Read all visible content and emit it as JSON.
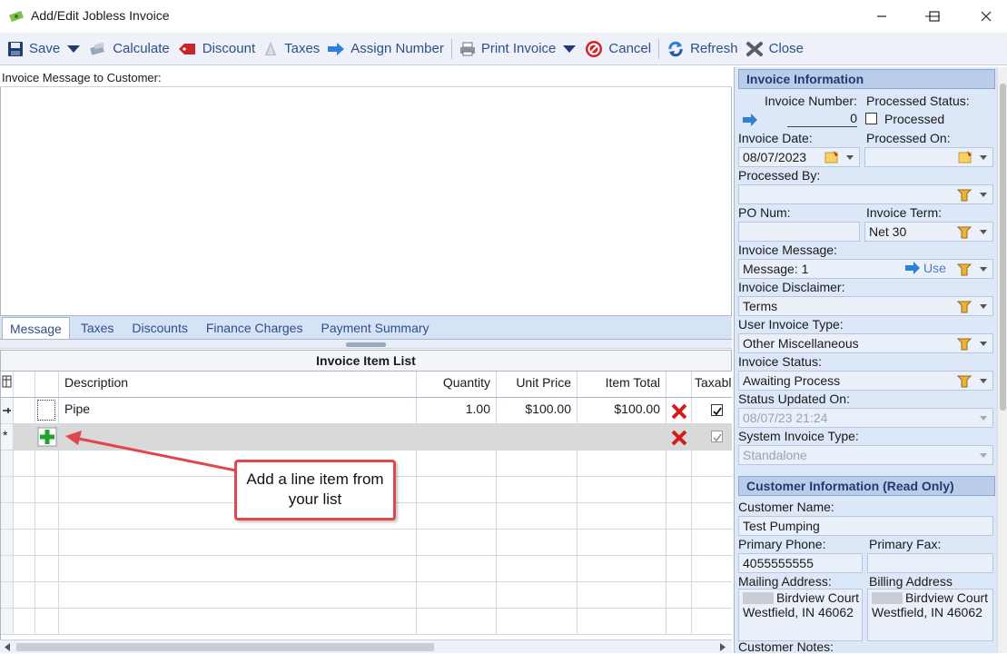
{
  "window": {
    "title": "Add/Edit Jobless Invoice",
    "minimize": "—",
    "maximize": "☐",
    "close": "✕"
  },
  "toolbar": {
    "save": "Save",
    "calculate": "Calculate",
    "discount": "Discount",
    "taxes": "Taxes",
    "assign_number": "Assign Number",
    "print_invoice": "Print Invoice",
    "cancel": "Cancel",
    "refresh": "Refresh",
    "close": "Close"
  },
  "message": {
    "label": "Invoice Message to Customer:",
    "value": ""
  },
  "tabs": [
    "Message",
    "Taxes",
    "Discounts",
    "Finance Charges",
    "Payment Summary"
  ],
  "grid": {
    "caption": "Invoice Item List",
    "columns": {
      "icon": "",
      "description": "Description",
      "quantity": "Quantity",
      "unit_price": "Unit Price",
      "item_total": "Item Total",
      "taxable": "Taxabl"
    },
    "rows": [
      {
        "description": "Pipe",
        "quantity": "1.00",
        "unit_price": "$100.00",
        "item_total": "$100.00",
        "taxable": true
      }
    ],
    "new_row_marker": "*"
  },
  "callout": {
    "line1": "Add a line item from",
    "line2": "your list"
  },
  "invoice_info": {
    "header": "Invoice Information",
    "invoice_number_label": "Invoice Number:",
    "invoice_number": "0",
    "processed_status_label": "Processed Status:",
    "processed_label": "Processed",
    "processed": false,
    "invoice_date_label": "Invoice Date:",
    "invoice_date": "08/07/2023",
    "processed_on_label": "Processed On:",
    "processed_on": "",
    "processed_by_label": "Processed By:",
    "processed_by": "",
    "po_num_label": "PO Num:",
    "po_num": "",
    "invoice_term_label": "Invoice Term:",
    "invoice_term": "Net 30",
    "invoice_message_label": "Invoice Message:",
    "invoice_message": "Message: 1",
    "use_label": "Use",
    "invoice_disclaimer_label": "Invoice Disclaimer:",
    "invoice_disclaimer": "Terms",
    "user_invoice_type_label": "User Invoice Type:",
    "user_invoice_type": "Other Miscellaneous",
    "invoice_status_label": "Invoice Status:",
    "invoice_status": "Awaiting Process",
    "status_updated_label": "Status Updated On:",
    "status_updated": "08/07/23 21:24",
    "system_invoice_type_label": "System Invoice Type:",
    "system_invoice_type": "Standalone"
  },
  "customer_info": {
    "header": "Customer Information (Read Only)",
    "customer_name_label": "Customer Name:",
    "customer_name": "Test Pumping",
    "primary_phone_label": "Primary Phone:",
    "primary_phone": "4055555555",
    "primary_fax_label": "Primary Fax:",
    "primary_fax": "",
    "mailing_address_label": "Mailing Address:",
    "mailing_line1": "Birdview Court",
    "mailing_line2": "Westfield, IN 46062",
    "billing_address_label": "Billing Address",
    "billing_line1": "Birdview Court",
    "billing_line2": "Westfield, IN 46062",
    "customer_notes_label": "Customer Notes:"
  }
}
